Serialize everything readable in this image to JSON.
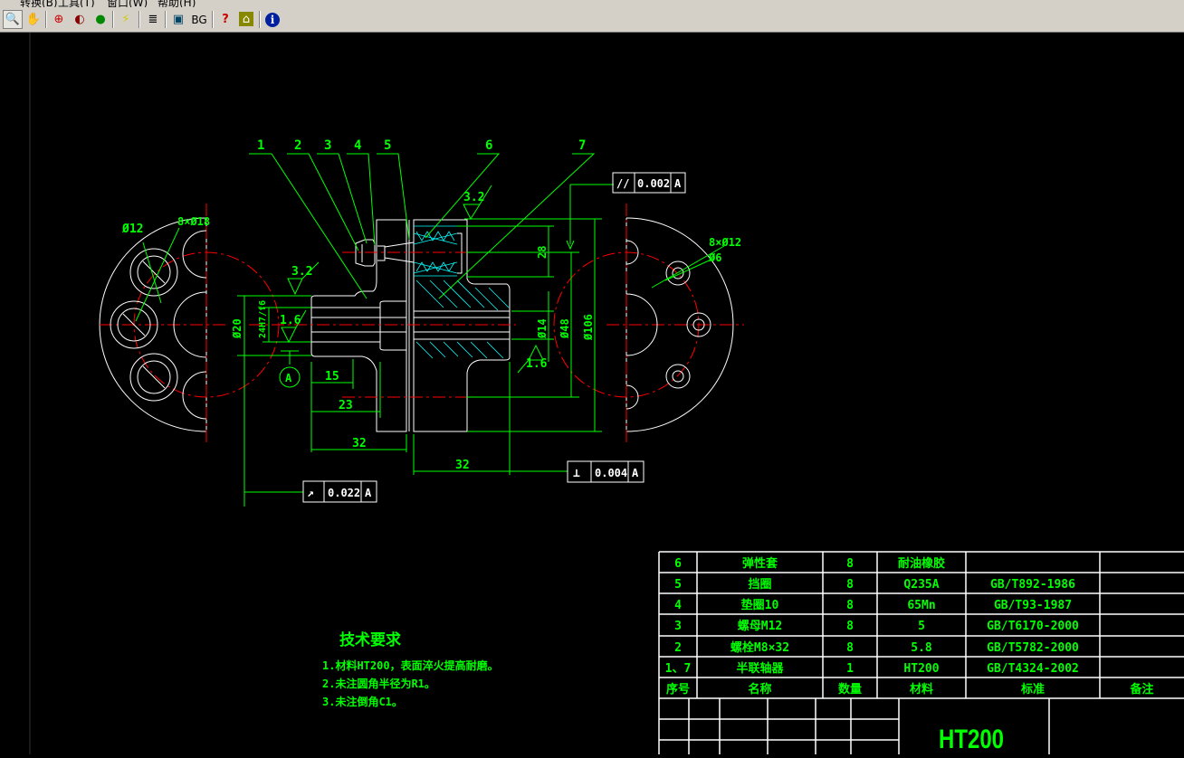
{
  "menu": [
    "转换(B)",
    "工具(T)",
    "窗口(W)",
    "帮助(H)"
  ],
  "toolbar": {
    "buttons": [
      {
        "name": "zoom-window-icon",
        "glyph": "🔍"
      },
      {
        "name": "pan-hand-icon",
        "glyph": "✋"
      },
      {
        "name": "zoom-in-icon",
        "glyph": "⊕"
      },
      {
        "name": "zoom-previous-icon",
        "glyph": "◐"
      },
      {
        "name": "view-3d-icon",
        "glyph": "●"
      },
      {
        "name": "measure-icon",
        "glyph": "⚡"
      },
      {
        "name": "layers-icon",
        "glyph": "≣"
      },
      {
        "name": "frame-icon",
        "glyph": "▣"
      },
      {
        "name": "background-icon",
        "glyph": "BG"
      },
      {
        "name": "help-icon",
        "glyph": "?"
      },
      {
        "name": "home-icon",
        "glyph": "⌂"
      },
      {
        "name": "info-icon",
        "glyph": "i"
      }
    ]
  },
  "colors": {
    "toolbar_bg": "#d4d0c8",
    "canvas_bg": "#000000",
    "annotation": "#00ff00",
    "geometry": "#ffffff",
    "centerline": "#ff0000",
    "hatch": "#00ffff"
  },
  "drawing": {
    "balloons": [
      "1",
      "2",
      "3",
      "4",
      "5",
      "6",
      "7"
    ],
    "dims": {
      "d12": "Ø12",
      "holes_left": "8×Ø18",
      "holes_right": "8×Ø12",
      "d6": "Ø6",
      "ra_top": "3.2",
      "ra_left": "3.2",
      "ra_bore": "1.6",
      "ra_right": "1.6",
      "d20": "Ø20",
      "fit": "24H7/f6",
      "datum": "A",
      "l15": "15",
      "l23": "23",
      "l32a": "32",
      "l32b": "32",
      "h28": "28",
      "d14": "Ø14",
      "d48": "Ø48",
      "d106": "Ø106"
    },
    "tolerances": {
      "parallel": {
        "symbol": "//",
        "value": "0.002",
        "datum": "A"
      },
      "perpendicular": {
        "symbol": "⊥",
        "value": "0.004",
        "datum": "A"
      },
      "runout": {
        "symbol": "↗",
        "value": "0.022",
        "datum": "A"
      }
    }
  },
  "tech": {
    "title": "技术要求",
    "lines": [
      "1.材料HT200，表面淬火提高耐磨。",
      "2.未注圆角半径为R1。",
      "3.未注倒角C1。"
    ]
  },
  "bom": {
    "rows": [
      [
        "6",
        "弹性套",
        "8",
        "耐油橡胶",
        "",
        ""
      ],
      [
        "5",
        "挡圈",
        "8",
        "Q235A",
        "GB/T892-1986",
        ""
      ],
      [
        "4",
        "垫圈10",
        "8",
        "65Mn",
        "GB/T93-1987",
        ""
      ],
      [
        "3",
        "螺母M12",
        "8",
        "5",
        "GB/T6170-2000",
        ""
      ],
      [
        "2",
        "螺栓M8×32",
        "8",
        "5.8",
        "GB/T5782-2000",
        ""
      ],
      [
        "1、7",
        "半联轴器",
        "1",
        "HT200",
        "GB/T4324-2002",
        ""
      ]
    ],
    "header": [
      "序号",
      "名称",
      "数量",
      "材料",
      "标准",
      "备注"
    ],
    "material": "HT200"
  }
}
